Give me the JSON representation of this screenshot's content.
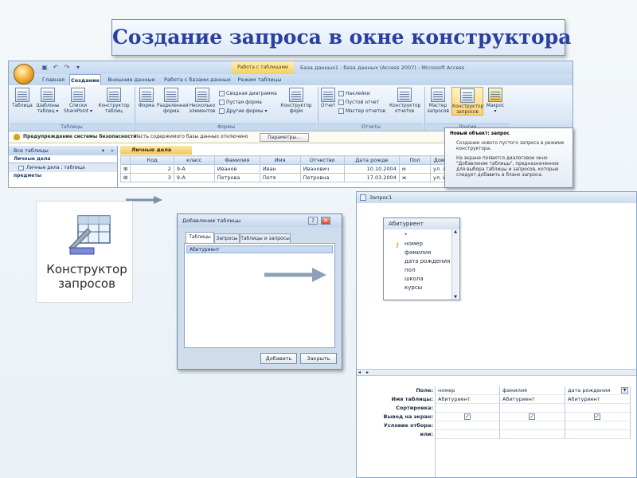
{
  "slide": {
    "title": "Создание запроса в окне конструктора"
  },
  "window": {
    "context_tab": "Работа с таблицами",
    "title": "База данных1 : база данных (Access 2007) - Microsoft Access",
    "tabs": [
      "Главная",
      "Создание",
      "Внешние данные",
      "Работа с базами данных",
      "Режим таблицы"
    ],
    "active_tab": "Создание"
  },
  "ribbon": {
    "tables": {
      "label": "Таблицы",
      "buttons": [
        "Таблица",
        "Шаблоны таблиц ▾",
        "Списки SharePoint ▾",
        "Конструктор таблиц"
      ]
    },
    "forms": {
      "label": "Формы",
      "buttons": [
        "Форма",
        "Разделенная форма",
        "Несколько элементов"
      ],
      "small": [
        "Сводная диаграмма",
        "Пустая форма",
        "Другие формы ▾"
      ],
      "design": "Конструктор форм"
    },
    "reports": {
      "label": "Отчеты",
      "buttons": [
        "Отчет"
      ],
      "small": [
        "Наклейки",
        "Пустой отчет",
        "Мастер отчетов"
      ],
      "design": "Конструктор отчетов"
    },
    "other": {
      "label": "Другие",
      "buttons": [
        "Мастер запросов",
        "Конструктор запросов",
        "Макрос ▾"
      ]
    }
  },
  "security": {
    "warning": "Предупреждение системы безопасности",
    "message": "Часть содержимого базы данных отключено",
    "button": "Параметры..."
  },
  "nav_pane": {
    "header": "Все таблицы",
    "groups": [
      {
        "name": "Личные дела",
        "items": [
          "Личные дела : таблица"
        ]
      },
      {
        "name": "предметы",
        "items": []
      }
    ]
  },
  "datasheet": {
    "tab": "Личные дела",
    "columns": [
      "Код",
      "класс",
      "Фамилия",
      "Имя",
      "Отчество",
      "Дата рожде",
      "Пол",
      "Домас"
    ],
    "rows": [
      [
        "2",
        "9-А",
        "Иванов",
        "Иван",
        "Иванович",
        "10.10.2004",
        "м",
        "ул. Ле"
      ],
      [
        "3",
        "9-А",
        "Петрова",
        "Петя",
        "Петровна",
        "17.03.2004",
        "ж",
        "ул. Ив"
      ]
    ]
  },
  "tooltip": {
    "title": "Новый объект: запрос",
    "line1": "Создание нового пустого запроса в режиме конструктора.",
    "line2": "На экране появится диалоговое окно \"Добавление таблицы\", предназначенное для выбора таблицы и запросов, которые следует добавить в бланк запроса."
  },
  "zoom_card": {
    "label": "Конструктор запросов"
  },
  "dialog": {
    "title": "Добавление таблицы",
    "help": "?",
    "close": "✕",
    "tabs": [
      "Таблицы",
      "Запросы",
      "Таблицы и запросы"
    ],
    "active_tab": "Таблицы",
    "items": [
      "Абитуриент"
    ],
    "add_button": "Добавить",
    "close_button": "Закрыть"
  },
  "query": {
    "title": "Запрос1",
    "table": "Абитуриент",
    "fields": [
      "*",
      "номер",
      "фамилия",
      "дата рождения",
      "пол",
      "школа",
      "курсы"
    ],
    "grid_labels": [
      "Поле:",
      "Имя таблицы:",
      "Сортировка:",
      "Вывод на экран:",
      "Условие отбора:",
      "или:"
    ],
    "columns": [
      {
        "field": "номер",
        "table": "Абитуриент",
        "show": true
      },
      {
        "field": "фамилия",
        "table": "Абитуриент",
        "show": true
      },
      {
        "field": "дата рождения",
        "table": "Абитуриент",
        "show": true
      }
    ]
  },
  "colors": {
    "accent": "#2b3f9e",
    "ribbon": "#dae7f5",
    "highlight": "#fdd36e"
  }
}
